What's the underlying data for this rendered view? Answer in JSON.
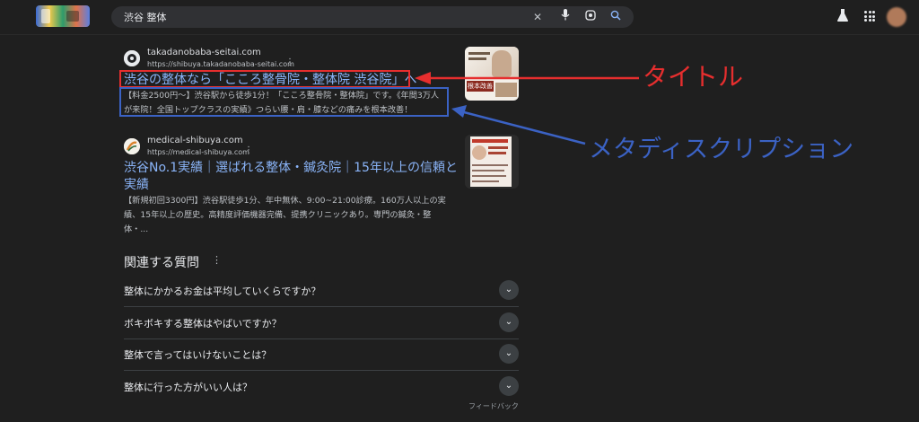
{
  "search": {
    "query": "渋谷 整体"
  },
  "results": [
    {
      "site": "takadanobaba-seitai.com",
      "url": "https://shibuya.takadanobaba-seitai.com",
      "title": "渋谷の整体なら「こころ整骨院・整体院 渋谷院」へ",
      "snippet_line1": "【料金2500円〜】渋谷駅から徒歩1分！「こころ整骨院・整体院」です。《年間3万人",
      "snippet_line2": "が来院！全国トップクラスの実績》つらい腰・肩・膝などの痛みを根本改善！",
      "thumb_text": "根本改善"
    },
    {
      "site": "medical-shibuya.com",
      "url": "https://medical-shibuya.com",
      "title_line1": "渋谷No.1実績｜選ばれる整体・鍼灸院｜15年以上の信頼と",
      "title_line2": "実績",
      "snippet_line1": "【新規初回3300円】渋谷駅徒歩1分、年中無休、9:00~21:00診療。160万人以上の実",
      "snippet_line2": "績、15年以上の歴史。高精度評価機器完備、提携クリニックあり。専門の鍼灸・整",
      "snippet_line3": "体・..."
    }
  ],
  "paa": {
    "heading": "関連する質問",
    "questions": [
      "整体にかかるお金は平均していくらですか？",
      "ボキボキする整体はやばいですか？",
      "整体で言ってはいけないことは？",
      "整体に行った方がいい人は？"
    ]
  },
  "feedback": "フィードバック",
  "annotations": {
    "title_label": "タイトル",
    "meta_label": "メタディスクリプション"
  },
  "colors": {
    "annotation_red": "#e62e2e",
    "annotation_blue": "#3b62c4",
    "link": "#8ab4f8"
  }
}
